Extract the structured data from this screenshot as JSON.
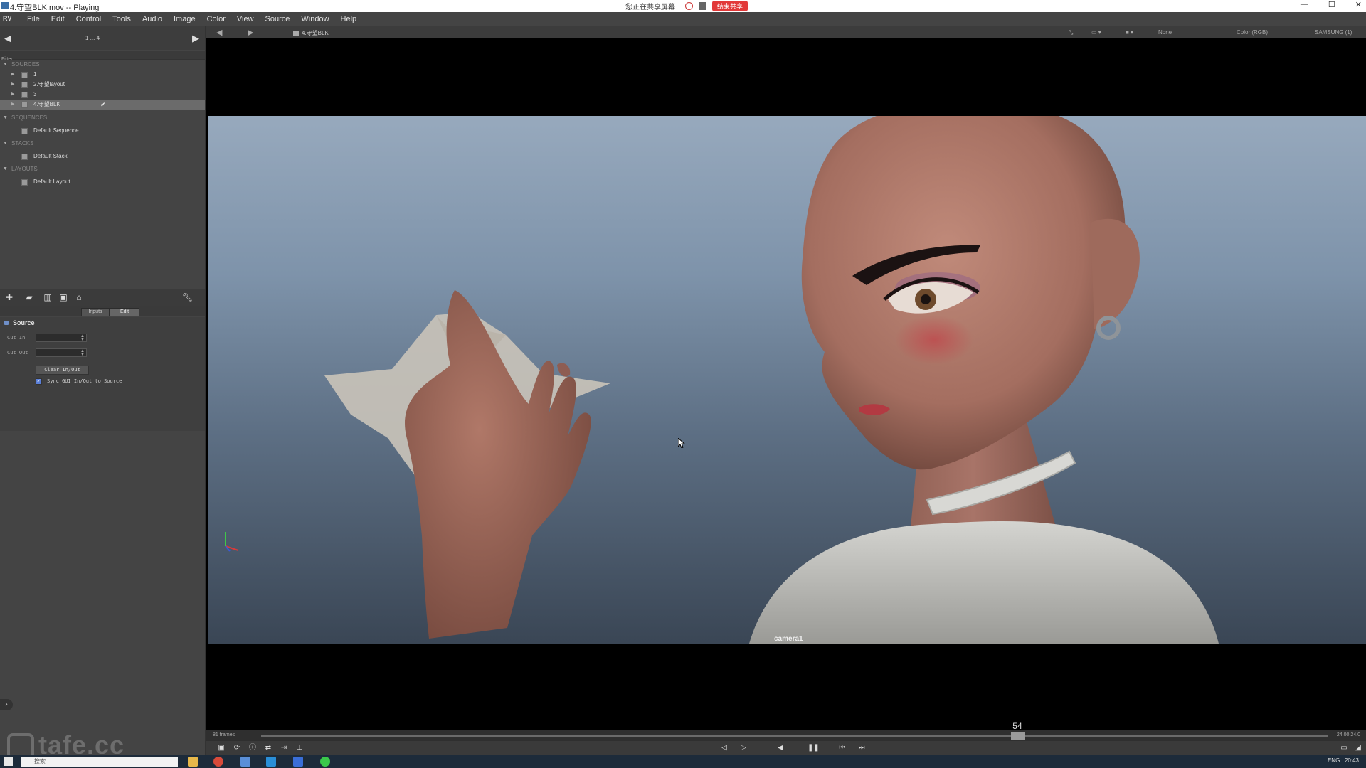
{
  "window": {
    "title": "4.守望BLK.mov -- Playing",
    "sharing_text": "您正在共享屏幕",
    "stop_share": "结束共享"
  },
  "menu": {
    "logo": "RV",
    "items": [
      "File",
      "Edit",
      "Control",
      "Tools",
      "Audio",
      "Image",
      "Color",
      "View",
      "Source",
      "Window",
      "Help"
    ]
  },
  "session": {
    "nav_title": "1 ... 4",
    "filter_placeholder": "Filter",
    "groups": {
      "sources": "SOURCES",
      "sequences": "SEQUENCES",
      "stacks": "STACKS",
      "layouts": "LAYOUTS"
    },
    "sources": [
      "1",
      "2.守望layout",
      "3",
      "4.守望BLK"
    ],
    "sequences": [
      "Default Sequence"
    ],
    "stacks": [
      "Default Stack"
    ],
    "layouts": [
      "Default Layout"
    ],
    "tabs": [
      "Inputs",
      "Edit"
    ],
    "source_panel": {
      "title": "Source",
      "cut_in_label": "Cut In",
      "cut_out_label": "Cut Out",
      "clear_button": "Clear In/Out",
      "sync_label": "Sync GUI In/Out to Source"
    }
  },
  "viewer": {
    "source_name": "4.守望BLK",
    "right_info": [
      "None",
      "Color (RGB)",
      "SAMSUNG (1)"
    ],
    "camera_label": "camera1"
  },
  "timeline": {
    "frames_label": "81 frames",
    "current_frame": "54",
    "progress": 0.71,
    "fps_label": "24.00  24.0"
  },
  "taskbar": {
    "search_placeholder": "搜索",
    "language": "ENG",
    "time": "20:43"
  },
  "watermark": "tafe.cc",
  "colors": {
    "sky_top": "#97a9bd",
    "sky_bottom": "#3a4655",
    "skin": "#b98274",
    "accent_stop": "#e23a3a",
    "checkbox": "#5a7fd8"
  }
}
